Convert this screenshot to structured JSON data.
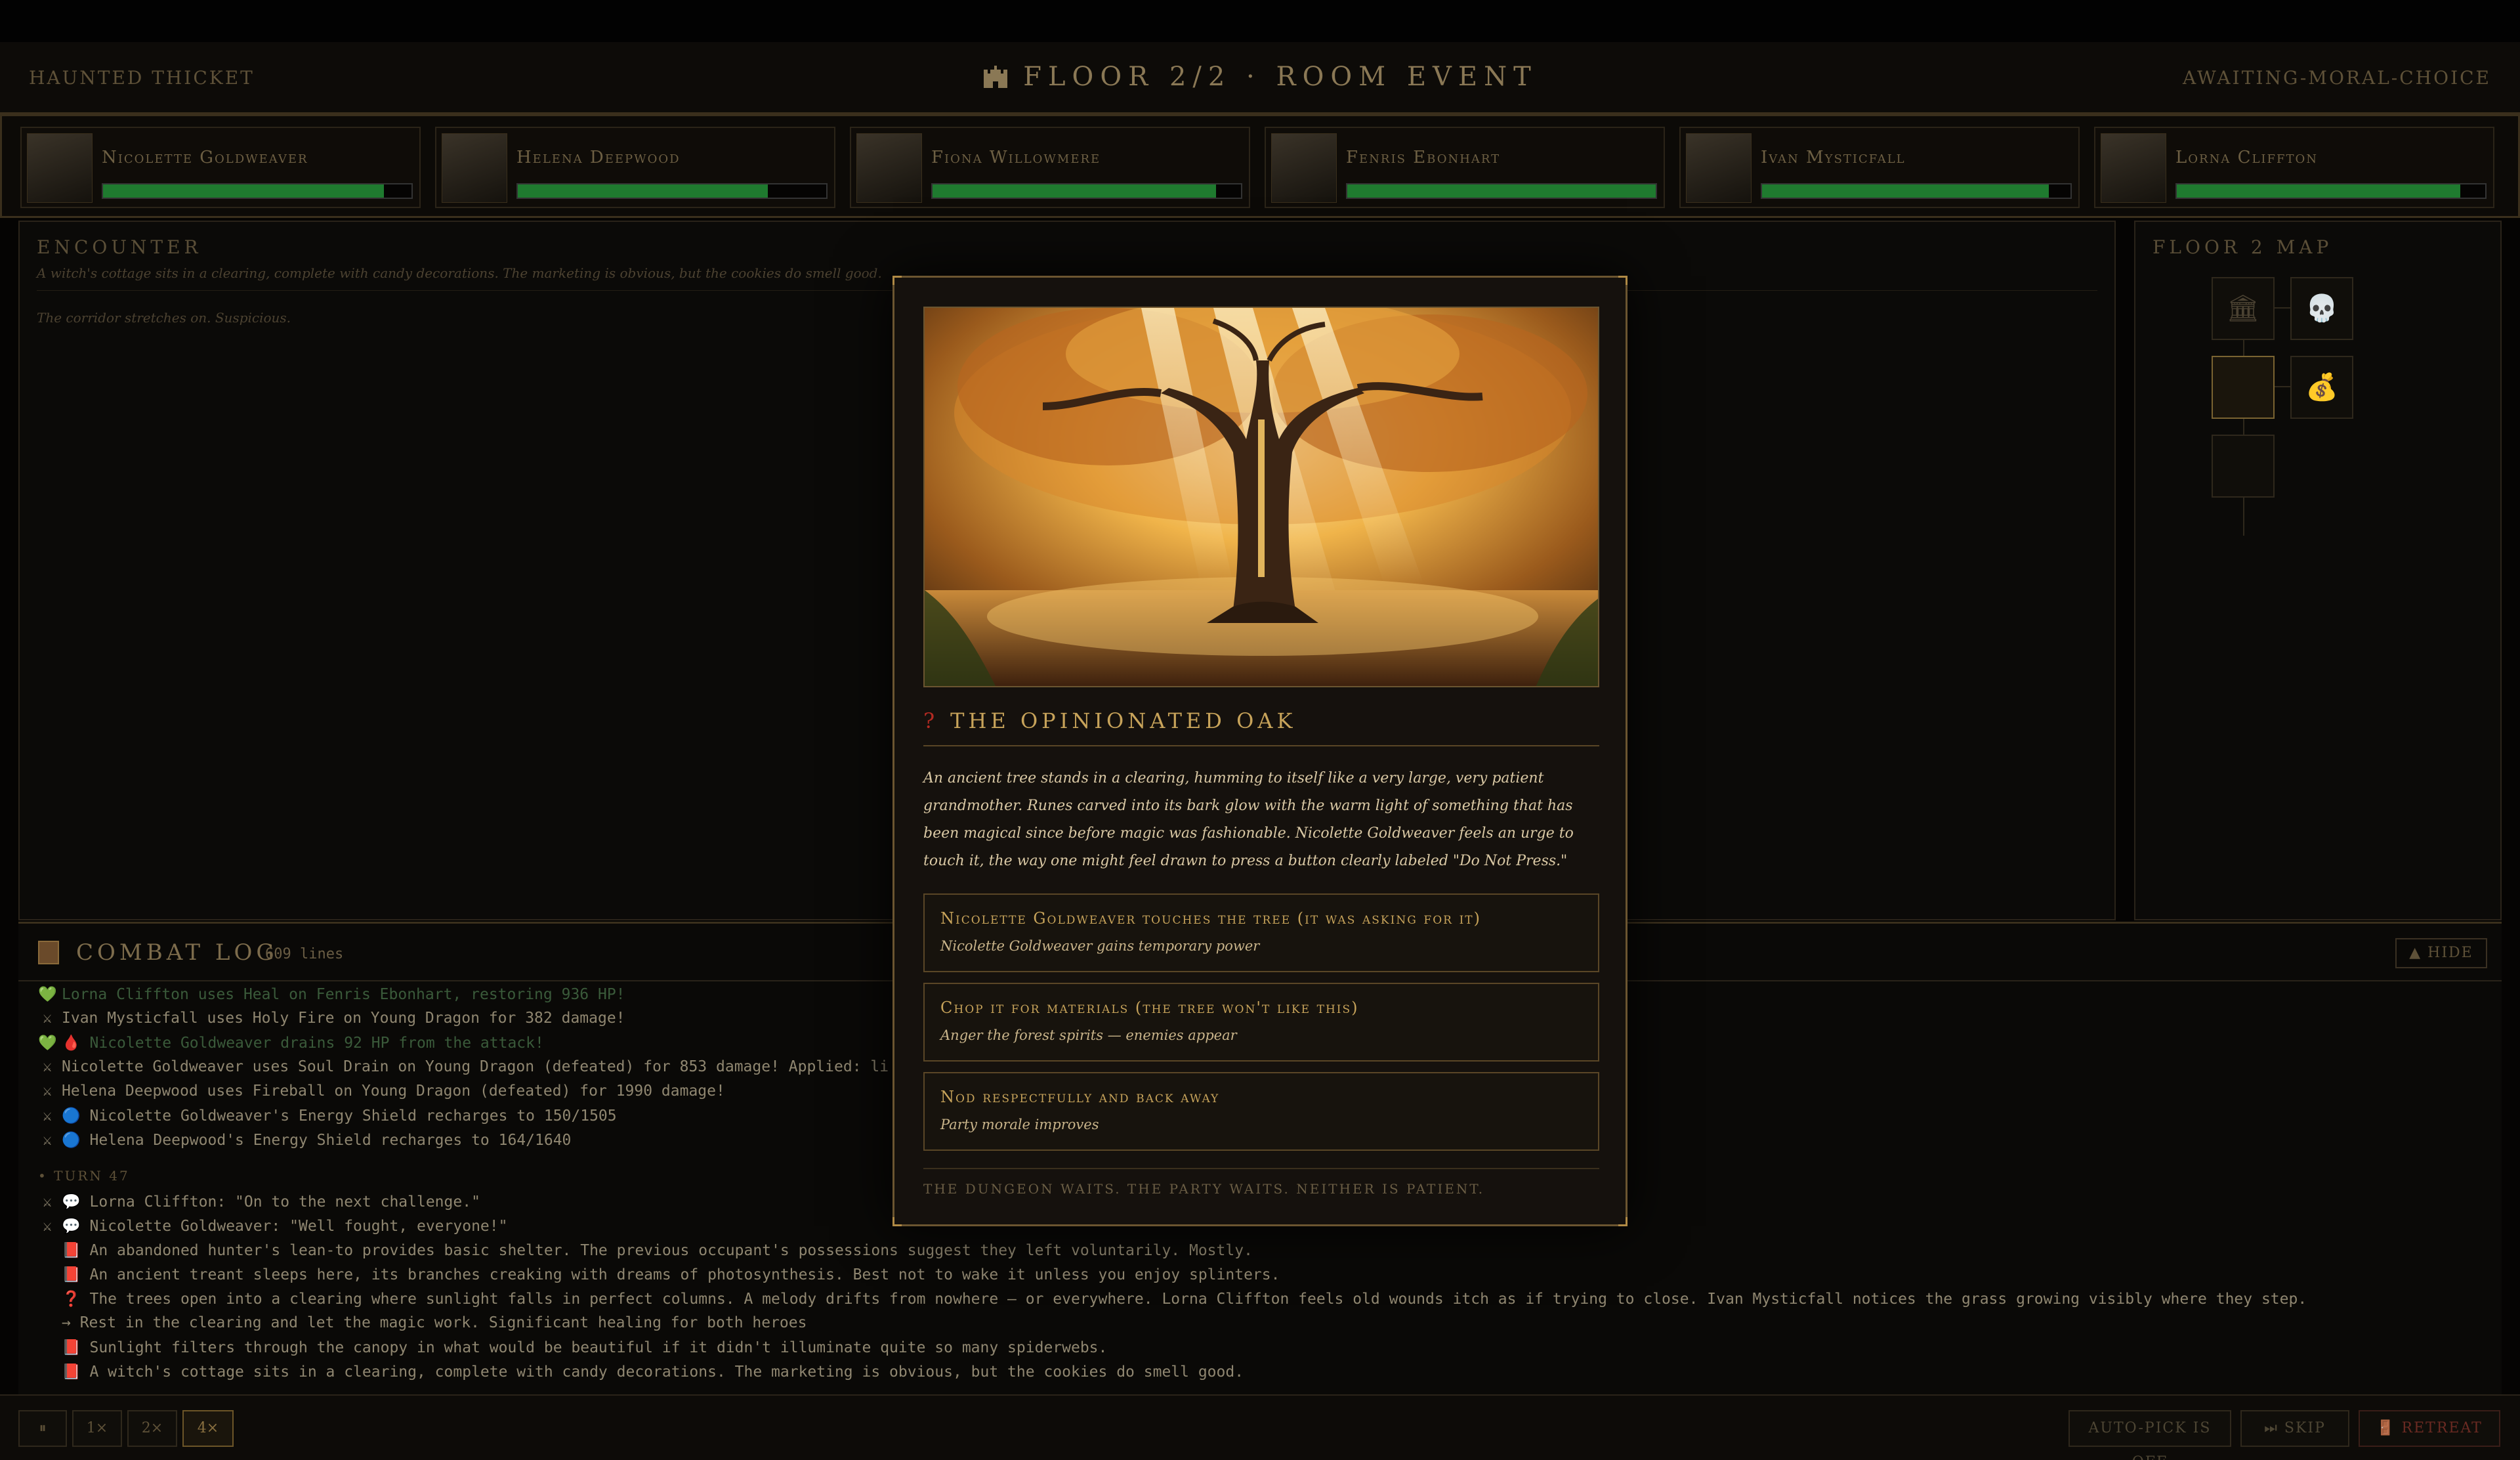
{
  "header": {
    "location": "HAUNTED THICKET",
    "title": "FLOOR 2/2 · ROOM EVENT",
    "status": "AWAITING-MORAL-CHOICE"
  },
  "party": [
    {
      "name": "Nicolette Goldweaver",
      "hp_fraction": 0.91
    },
    {
      "name": "Helena Deepwood",
      "hp_fraction": 0.81
    },
    {
      "name": "Fiona Willowmere",
      "hp_fraction": 0.92
    },
    {
      "name": "Fenris Ebonhart",
      "hp_fraction": 1.0
    },
    {
      "name": "Ivan Mysticfall",
      "hp_fraction": 0.93
    },
    {
      "name": "Lorna Cliffton",
      "hp_fraction": 0.92
    }
  ],
  "encounter": {
    "title": "ENCOUNTER",
    "flavor": "A witch's cottage sits in a clearing, complete with candy decorations. The marketing is obvious, but the cookies do smell good.",
    "narration": "The corridor stretches on. Suspicious."
  },
  "map": {
    "title": "FLOOR 2 MAP",
    "rooms": [
      {
        "icon": "🏛"
      },
      {
        "icon": "💀"
      },
      {
        "icon": ""
      },
      {
        "icon": "💰"
      },
      {
        "icon": ""
      }
    ]
  },
  "log": {
    "title": "COMBAT LOG",
    "count": "609 lines",
    "hide_label": "▲ HIDE",
    "lines": [
      {
        "icon": "💚",
        "text": "Lorna Cliffton uses Heal on Fenris Ebonhart, restoring 936 HP!",
        "style": "heal"
      },
      {
        "icon": "⚔",
        "text": "Ivan Mysticfall uses Holy Fire on Young Dragon for 382 damage!",
        "style": ""
      },
      {
        "icon": "💚",
        "text": "🩸 Nicolette Goldweaver drains 92 HP from the attack!",
        "style": "heal"
      },
      {
        "icon": "⚔",
        "text": "Nicolette Goldweaver uses Soul Drain on Young Dragon (defeated) for 853 damage! Applied: li",
        "style": ""
      },
      {
        "icon": "⚔",
        "text": "Helena Deepwood uses Fireball on Young Dragon (defeated) for 1990 damage!",
        "style": ""
      },
      {
        "icon": "⚔",
        "text": "🔵 Nicolette Goldweaver's Energy Shield recharges to 150/1505",
        "style": ""
      },
      {
        "icon": "⚔",
        "text": "🔵 Helena Deepwood's Energy Shield recharges to 164/1640",
        "style": ""
      }
    ],
    "turn_label": "• TURN 47",
    "turn_lines": [
      {
        "icon": "⚔",
        "text": "💬 Lorna Cliffton: \"On to the next challenge.\""
      },
      {
        "icon": "⚔",
        "text": "💬 Nicolette Goldweaver: \"Well fought, everyone!\""
      },
      {
        "icon": "",
        "text": "📕 An abandoned hunter's lean-to provides basic shelter. The previous occupant's possessions suggest they left voluntarily. Mostly."
      },
      {
        "icon": "",
        "text": "📕 An ancient treant sleeps here, its branches creaking with dreams of photosynthesis. Best not to wake it unless you enjoy splinters."
      },
      {
        "icon": "",
        "text": "❓ The trees open into a clearing where sunlight falls in perfect columns. A melody drifts from nowhere — or everywhere. Lorna Cliffton feels old wounds itch as if trying to close. Ivan Mysticfall notices the grass growing visibly where they step."
      },
      {
        "icon": "",
        "text": "→ Rest in the clearing and let the magic work. Significant healing for both heroes"
      },
      {
        "icon": "",
        "text": "📕 Sunlight filters through the canopy in what would be beautiful if it didn't illuminate quite so many spiderwebs."
      },
      {
        "icon": "",
        "text": "📕 A witch's cottage sits in a clearing, complete with candy decorations. The marketing is obvious, but the cookies do smell good."
      }
    ]
  },
  "controls": {
    "pause": "⏸",
    "speed1": "1×",
    "speed2": "2×",
    "speed4": "4×",
    "autopick": "AUTO-PICK IS OFF",
    "skip": "⏭ SKIP",
    "retreat": "🚪 RETREAT"
  },
  "event": {
    "title": "THE OPINIONATED OAK",
    "description": "An ancient tree stands in a clearing, humming to itself like a very large, very patient grandmother. Runes carved into its bark glow with the warm light of something that has been magical since before magic was fashionable. Nicolette Goldweaver feels an urge to touch it, the way one might feel drawn to press a button clearly labeled \"Do Not Press.\"",
    "choices": [
      {
        "title": "Nicolette Goldweaver touches the tree (it was asking for it)",
        "subtitle": "Nicolette Goldweaver gains temporary power"
      },
      {
        "title": "Chop it for materials (the tree won't like this)",
        "subtitle": "Anger the forest spirits — enemies appear"
      },
      {
        "title": "Nod respectfully and back away",
        "subtitle": "Party morale improves"
      }
    ],
    "footer": "THE DUNGEON WAITS. THE PARTY WAITS. NEITHER IS PATIENT."
  },
  "colors": {
    "gold_accent": "#c7a35a",
    "hp_green": "#1f7a2f",
    "retreat_red": "#6a2a22"
  }
}
